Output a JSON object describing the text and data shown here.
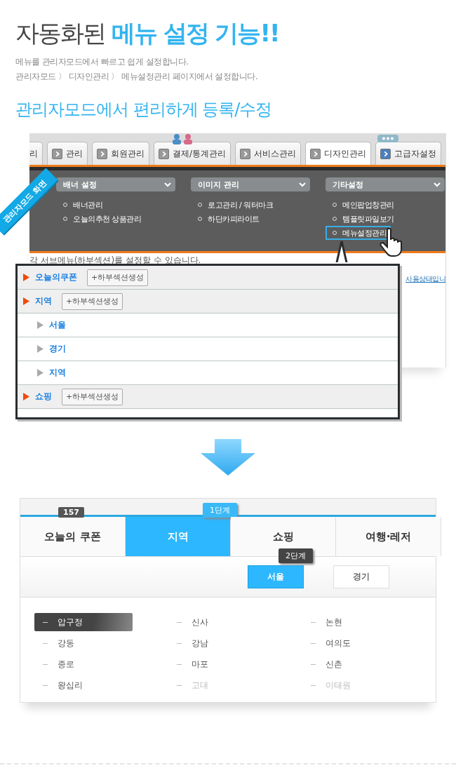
{
  "headline": "자동화된 **메뉴 설정 기능!!**",
  "description": [
    "메뉴를 관리자모드에서 빠르고 쉽게 설정합니다.",
    "관리자모드 〉 디자인관리 〉 메뉴설정관리 페이지에서 설정합니다."
  ],
  "subheading": "관리자모드에서 편리하게 등록/수정",
  "admin_screen": {
    "ribbon": "관리자모드 화면",
    "tabs": [
      {
        "label": "리",
        "selected": false
      },
      {
        "label": "관리",
        "selected": false
      },
      {
        "label": "회원관리",
        "selected": false
      },
      {
        "label": "결제/통계관리",
        "selected": false
      },
      {
        "label": "서비스관리",
        "selected": false
      },
      {
        "label": "디자인관리",
        "selected": true
      },
      {
        "label": "고급자설정",
        "selected": false
      }
    ],
    "menu_groups": [
      {
        "title": "배너 설정",
        "items": [
          {
            "label": "배너관리",
            "selected": false
          },
          {
            "label": "오늘의추천 상품관리",
            "selected": false
          }
        ]
      },
      {
        "title": "이미지 관리",
        "items": [
          {
            "label": "로고관리 / 워터마크",
            "selected": false
          },
          {
            "label": "하단카피라이트",
            "selected": false
          }
        ]
      },
      {
        "title": "기타설정",
        "items": [
          {
            "label": "메인팝업창관리",
            "selected": false
          },
          {
            "label": "템플릿파일보기",
            "selected": false
          },
          {
            "label": "메뉴설정관리",
            "selected": true
          }
        ]
      }
    ],
    "notice": "각 서브메뉴(하부섹션)를 설정할 수 있습니다.",
    "link": "사용상태입니"
  },
  "menu_editor": {
    "rows": [
      {
        "label": "오늘의쿠폰",
        "button": "+하부섹션생성",
        "children": []
      },
      {
        "label": "지역",
        "button": "+하부섹션생성",
        "children": [
          {
            "label": "서울"
          },
          {
            "label": "경기"
          },
          {
            "label": "지역"
          }
        ]
      },
      {
        "label": "쇼핑",
        "button": "+하부섹션생성",
        "children": []
      }
    ]
  },
  "front_screen": {
    "tabs": [
      {
        "label": "오늘의 쿠폰",
        "selected": false,
        "badge": "157"
      },
      {
        "label": "지역",
        "selected": true,
        "step": "1단계"
      },
      {
        "label": "쇼핑",
        "selected": false
      },
      {
        "label": "여행·레저",
        "selected": false
      }
    ],
    "sub_buttons": [
      {
        "label": "서울",
        "selected": true,
        "step": "2단계"
      },
      {
        "label": "경기",
        "selected": false
      }
    ],
    "regions": [
      {
        "label": "압구정",
        "selected": true,
        "disabled": false
      },
      {
        "label": "신사",
        "selected": false,
        "disabled": false
      },
      {
        "label": "논현",
        "selected": false,
        "disabled": false
      },
      {
        "label": "강동",
        "selected": false,
        "disabled": false
      },
      {
        "label": "강남",
        "selected": false,
        "disabled": false
      },
      {
        "label": "여의도",
        "selected": false,
        "disabled": false
      },
      {
        "label": "종로",
        "selected": false,
        "disabled": false
      },
      {
        "label": "마포",
        "selected": false,
        "disabled": false
      },
      {
        "label": "신촌",
        "selected": false,
        "disabled": false
      },
      {
        "label": "왕십리",
        "selected": false,
        "disabled": false
      },
      {
        "label": "고대",
        "selected": false,
        "disabled": true
      },
      {
        "label": "이태원",
        "selected": false,
        "disabled": true
      }
    ]
  }
}
